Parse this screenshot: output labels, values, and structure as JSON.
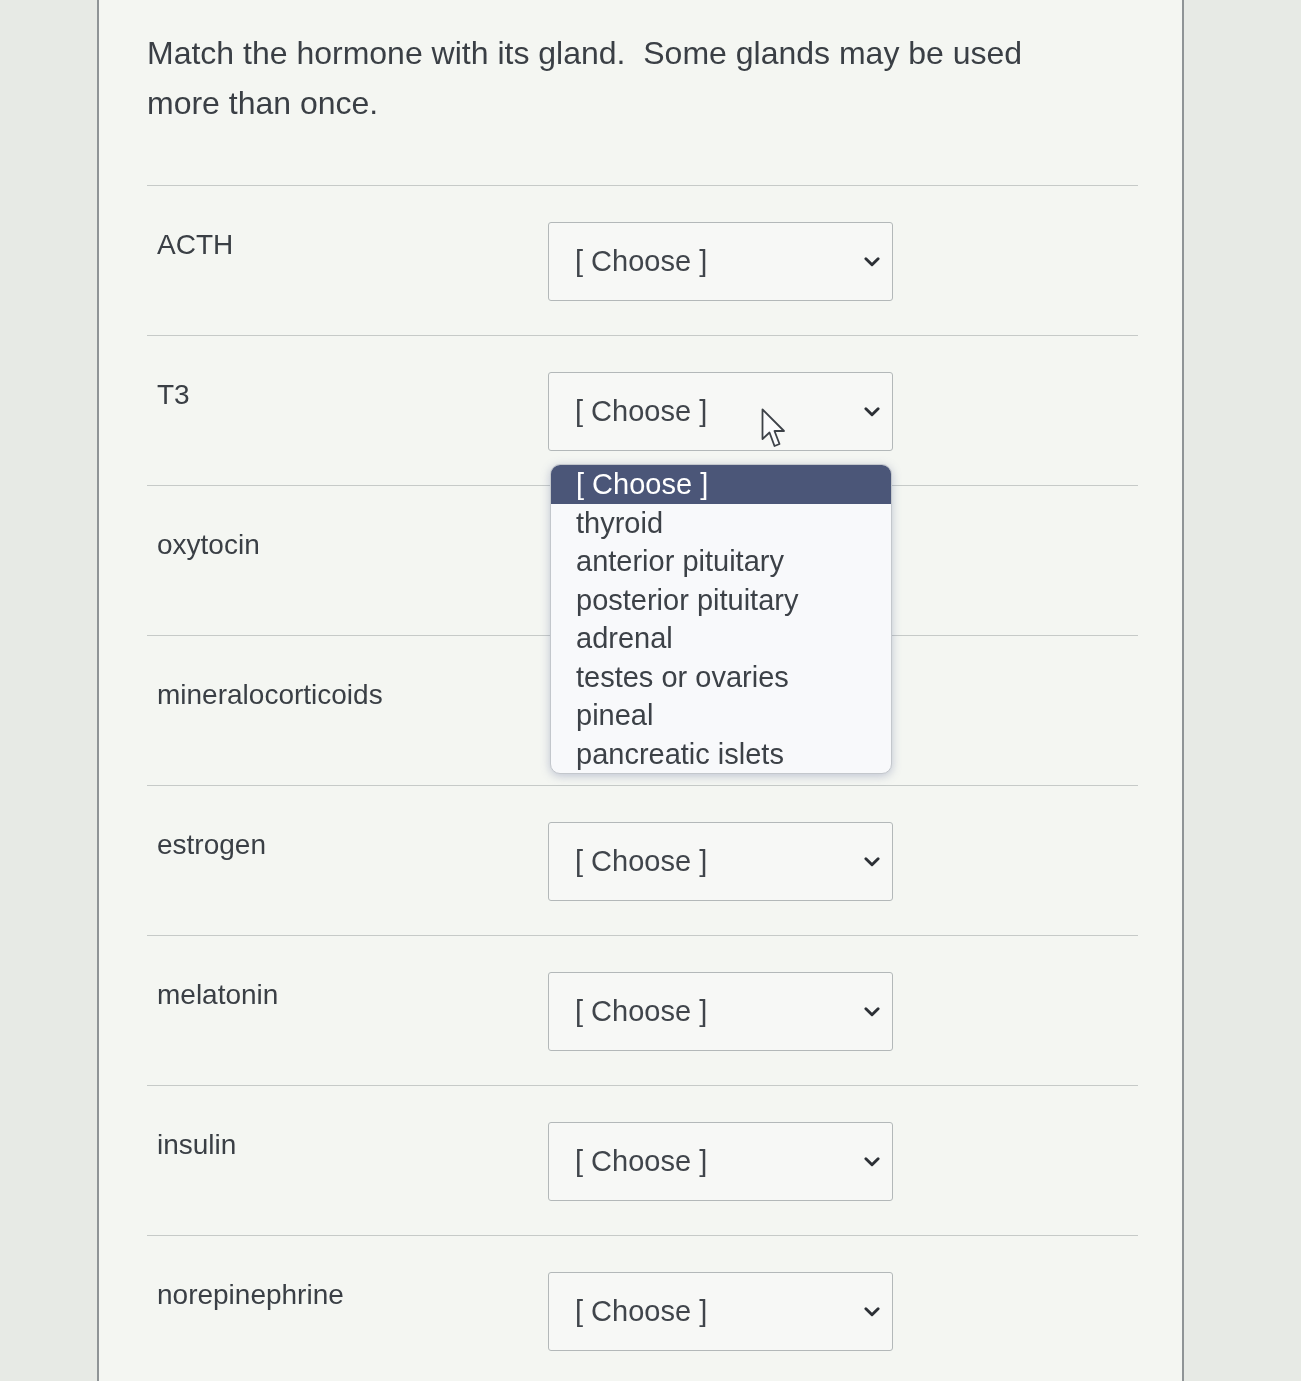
{
  "question": "Match the hormone with its gland.  Some glands may be used more than once.",
  "rows": [
    {
      "hormone": "ACTH",
      "select": {
        "value": "[ Choose ]",
        "expanded": false
      }
    },
    {
      "hormone": "T3",
      "select": {
        "value": "[ Choose ]",
        "expanded": true,
        "options": [
          {
            "label": "[ Choose ]",
            "selected": true
          },
          {
            "label": "thyroid",
            "selected": false
          },
          {
            "label": "anterior pituitary",
            "selected": false
          },
          {
            "label": "posterior pituitary",
            "selected": false
          },
          {
            "label": "adrenal",
            "selected": false
          },
          {
            "label": "testes or ovaries",
            "selected": false
          },
          {
            "label": "pineal",
            "selected": false
          },
          {
            "label": "pancreatic islets",
            "selected": false
          }
        ]
      }
    },
    {
      "hormone": "oxytocin"
    },
    {
      "hormone": "mineralocorticoids"
    },
    {
      "hormone": "estrogen",
      "select": {
        "value": "[ Choose ]",
        "expanded": false
      }
    },
    {
      "hormone": "melatonin",
      "select": {
        "value": "[ Choose ]",
        "expanded": false
      }
    },
    {
      "hormone": "insulin",
      "select": {
        "value": "[ Choose ]",
        "expanded": false
      }
    },
    {
      "hormone": "norepinephrine",
      "select": {
        "value": "[ Choose ]",
        "expanded": false
      }
    }
  ]
}
